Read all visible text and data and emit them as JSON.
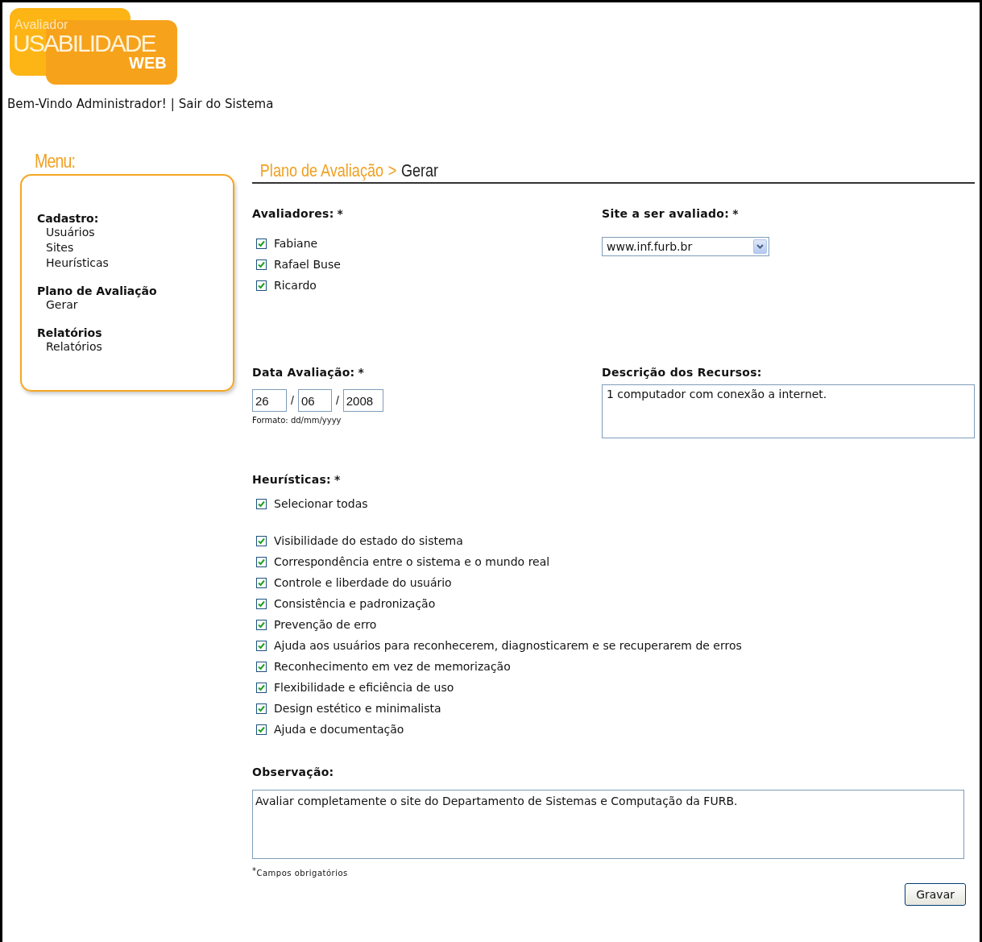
{
  "logo": {
    "line_1": "Avaliador",
    "line_2": "USABILIDADE",
    "line_3": "WEB"
  },
  "user_bar": {
    "greeting": "Bem-Vindo Administrador!",
    "separator": "|",
    "logout_link": "Sair do Sistema"
  },
  "menu": {
    "title": "Menu:",
    "sections": [
      {
        "heading": "Cadastro:",
        "items": [
          "Usuários",
          "Sites",
          "Heurísticas"
        ]
      },
      {
        "heading": "Plano de Avaliação",
        "items": [
          "Gerar"
        ]
      },
      {
        "heading": "Relatórios",
        "items": [
          "Relatórios"
        ]
      }
    ]
  },
  "breadcrumb": {
    "parent": "Plano de Avaliação",
    "separator": ">",
    "current": "Gerar"
  },
  "evaluators": {
    "label": "Avaliadores:",
    "required_mark": "*",
    "options": [
      {
        "label": "Fabiane",
        "checked": true
      },
      {
        "label": "Rafael Buse",
        "checked": true
      },
      {
        "label": "Ricardo",
        "checked": true
      }
    ]
  },
  "site": {
    "label": "Site a ser avaliado:",
    "required_mark": "*",
    "value": "www.inf.furb.br"
  },
  "date": {
    "label": "Data Avaliação:",
    "required_mark": "*",
    "day": "26",
    "month": "06",
    "year": "2008",
    "separators": [
      "/",
      "/"
    ],
    "hint": "Formato: dd/mm/yyyy"
  },
  "resources": {
    "label": "Descrição dos Recursos:",
    "value": "1 computador com conexão a internet."
  },
  "heuristics": {
    "label": "Heurísticas:",
    "required_mark": "*",
    "select_all": {
      "label": "Selecionar todas",
      "checked": true
    },
    "options": [
      {
        "label": "Visibilidade do estado do sistema",
        "checked": true
      },
      {
        "label": "Correspondência entre o sistema e o mundo real",
        "checked": true
      },
      {
        "label": "Controle e liberdade do usuário",
        "checked": true
      },
      {
        "label": "Consistência e padronização",
        "checked": true
      },
      {
        "label": "Prevenção de erro",
        "checked": true
      },
      {
        "label": "Ajuda aos usuários para reconhecerem, diagnosticarem e se recuperarem de erros",
        "checked": true
      },
      {
        "label": "Reconhecimento em vez de memorização",
        "checked": true
      },
      {
        "label": "Flexibilidade e eficiência de uso",
        "checked": true
      },
      {
        "label": "Design estético e minimalista",
        "checked": true
      },
      {
        "label": "Ajuda e documentação",
        "checked": true
      }
    ]
  },
  "observation": {
    "label": "Observação:",
    "value": "Avaliar completamente o site do Departamento de Sistemas e Computação da FURB."
  },
  "required_note": {
    "mark": "*",
    "text": "Campos obrigatórios"
  },
  "save_button": "Gravar"
}
